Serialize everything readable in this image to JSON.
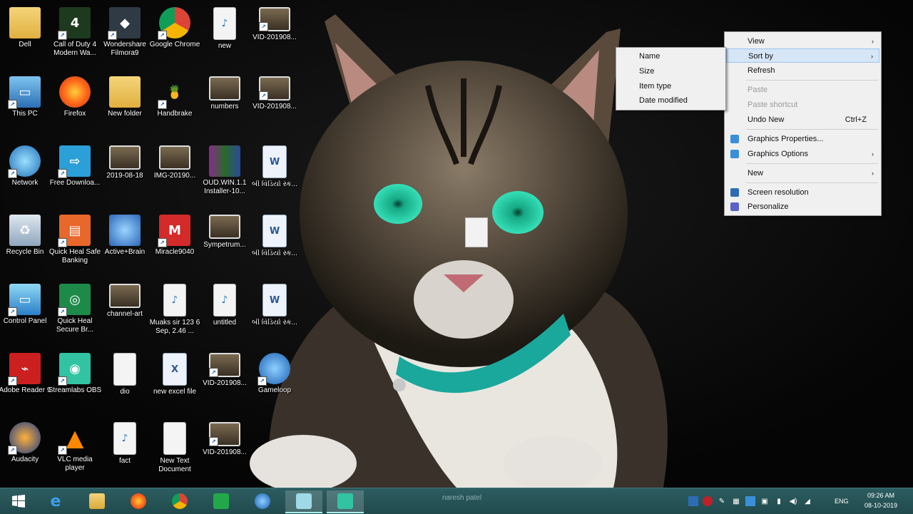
{
  "desktop": {
    "icons": [
      {
        "label": "Dell",
        "icon": "folder-user-icon"
      },
      {
        "label": "This PC",
        "icon": "computer-icon"
      },
      {
        "label": "Network",
        "icon": "network-globe-icon"
      },
      {
        "label": "Recycle Bin",
        "icon": "recycle-bin-icon"
      },
      {
        "label": "Control Panel",
        "icon": "control-panel-icon"
      },
      {
        "label": "Adobe Reader 9",
        "icon": "adobe-reader-icon"
      },
      {
        "label": "Audacity",
        "icon": "audacity-icon"
      },
      {
        "label": "Call of Duty 4 Modern Wa...",
        "icon": "cod4-icon"
      },
      {
        "label": "Firefox",
        "icon": "firefox-icon"
      },
      {
        "label": "Free Downloa...",
        "icon": "free-download-icon"
      },
      {
        "label": "Quick Heal Safe Banking",
        "icon": "quick-heal-safe-banking-icon"
      },
      {
        "label": "Quick Heal Secure Br...",
        "icon": "quick-heal-browser-icon"
      },
      {
        "label": "Streamlabs OBS",
        "icon": "streamlabs-icon"
      },
      {
        "label": "VLC media player",
        "icon": "vlc-icon"
      },
      {
        "label": "Wondershare Filmora9",
        "icon": "filmora-icon"
      },
      {
        "label": "New folder",
        "icon": "folder-icon"
      },
      {
        "label": "2019-08-18",
        "icon": "image-file-icon"
      },
      {
        "label": "Active+Brain",
        "icon": "brain-icon"
      },
      {
        "label": "channel-art",
        "icon": "image-file-icon"
      },
      {
        "label": "dio",
        "icon": "blank-file-icon"
      },
      {
        "label": "fact",
        "icon": "audio-file-icon"
      },
      {
        "label": "Google Chrome",
        "icon": "chrome-icon"
      },
      {
        "label": "Handbrake",
        "icon": "handbrake-icon"
      },
      {
        "label": "IMG-20190...",
        "icon": "image-file-icon"
      },
      {
        "label": "Miracle9040",
        "icon": "miracle-icon"
      },
      {
        "label": "Muaks sir 123 6 Sep, 2.46 ...",
        "icon": "audio-file-icon"
      },
      {
        "label": "new excel file",
        "icon": "excel-file-icon"
      },
      {
        "label": "New Text Document",
        "icon": "text-file-icon"
      },
      {
        "label": "new",
        "icon": "audio-file-icon"
      },
      {
        "label": "numbers",
        "icon": "image-file-icon"
      },
      {
        "label": "OUD.WIN.1.1 Installer-10...",
        "icon": "winrar-icon"
      },
      {
        "label": "Sympetrum...",
        "icon": "image-file-icon"
      },
      {
        "label": "untitled",
        "icon": "audio-file-icon"
      },
      {
        "label": "VID-201908...",
        "icon": "video-file-icon"
      },
      {
        "label": "VID-201908...",
        "icon": "video-file-icon"
      },
      {
        "label": "VID-201908...",
        "icon": "video-file-icon"
      },
      {
        "label": "VID-201908...",
        "icon": "video-file-icon"
      },
      {
        "label": "બી વિડિયો સ્ક...",
        "icon": "word-file-icon"
      },
      {
        "label": "બી વિડિયો સ્ક...",
        "icon": "word-file-icon"
      },
      {
        "label": "બી વિડિયો સ્ક...",
        "icon": "word-file-icon"
      },
      {
        "label": "Gameloop",
        "icon": "gameloop-icon"
      }
    ]
  },
  "context_menu": {
    "items": [
      {
        "label": "View",
        "arrow": "›",
        "state": "normal"
      },
      {
        "label": "Sort by",
        "arrow": "›",
        "state": "highlighted"
      },
      {
        "label": "Refresh",
        "state": "normal"
      },
      {
        "label": "Paste",
        "state": "disabled"
      },
      {
        "label": "Paste shortcut",
        "state": "disabled"
      },
      {
        "label": "Undo New",
        "shortcut": "Ctrl+Z",
        "state": "normal"
      },
      {
        "label": "Graphics Properties...",
        "state": "normal"
      },
      {
        "label": "Graphics Options",
        "arrow": "›",
        "state": "normal"
      },
      {
        "label": "New",
        "arrow": "›",
        "state": "normal"
      },
      {
        "label": "Screen resolution",
        "state": "normal"
      },
      {
        "label": "Personalize",
        "state": "normal"
      }
    ]
  },
  "sort_submenu": {
    "items": [
      "Name",
      "Size",
      "Item type",
      "Date modified"
    ]
  },
  "taskbar": {
    "title": "naresh patel",
    "language": "ENG",
    "time": "09:26 AM",
    "date": "08-10-2019",
    "apps": [
      "start-icon",
      "internet-explorer-icon",
      "file-explorer-icon",
      "firefox-icon",
      "chrome-icon",
      "store-icon",
      "gameloop-icon",
      "notepad-icon",
      "streamlabs-icon"
    ]
  },
  "colors": {
    "taskbar": "#24504f",
    "menu_highlight": "#d6e6f7",
    "cat_eye": "#1fc9a0",
    "collar": "#22b3a6"
  }
}
